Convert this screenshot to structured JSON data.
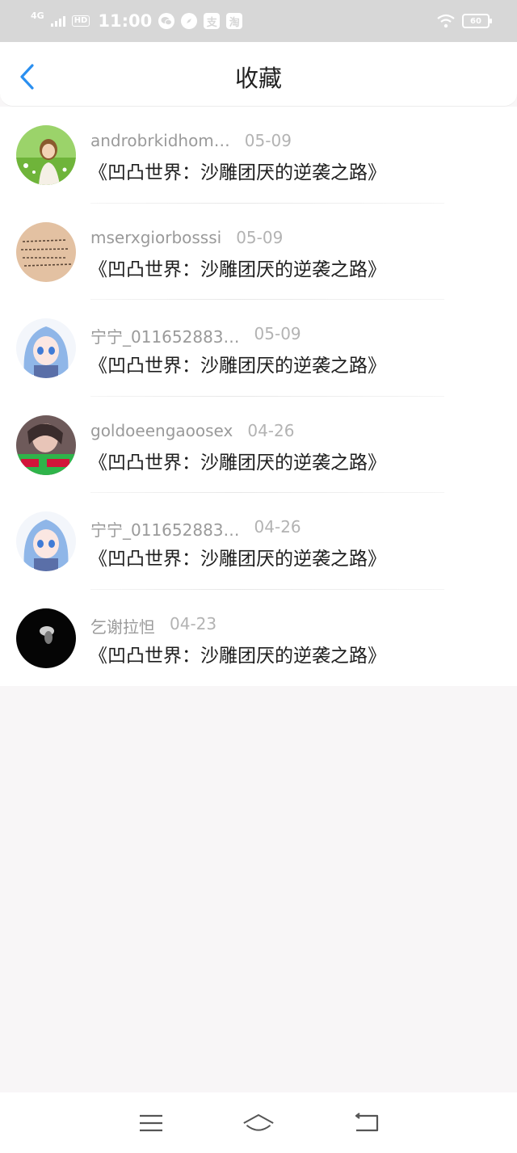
{
  "status_bar": {
    "network": "4G",
    "hd": "HD",
    "time": "11:00",
    "icons": [
      "wechat-icon",
      "compass-icon",
      "alipay-icon",
      "taobao-icon"
    ],
    "icon_glyphs": [
      "",
      "",
      "支",
      "淘"
    ],
    "battery": "60"
  },
  "header": {
    "title": "收藏",
    "back_icon": "chevron-left-icon",
    "accent": "#2a8ff0"
  },
  "items": [
    {
      "name": "androbrkidhom…",
      "date": "05-09",
      "book": "《凹凸世界：沙雕团厌的逆袭之路》",
      "avatar": "girl-field-photo"
    },
    {
      "name": "mserxgiorbosssi",
      "date": "05-09",
      "book": "《凹凸世界：沙雕团厌的逆袭之路》",
      "avatar": "handwriting-photo"
    },
    {
      "name": "宁宁_011652883…",
      "date": "05-09",
      "book": "《凹凸世界：沙雕团厌的逆袭之路》",
      "avatar": "anime-girl-blue"
    },
    {
      "name": "goldoeengaoosex",
      "date": "04-26",
      "book": "《凹凸世界：沙雕团厌的逆袭之路》",
      "avatar": "girl-green-banner"
    },
    {
      "name": "宁宁_011652883…",
      "date": "04-26",
      "book": "《凹凸世界：沙雕团厌的逆袭之路》",
      "avatar": "anime-girl-blue"
    },
    {
      "name": "乞谢拉怛",
      "date": "04-23",
      "book": "《凹凸世界：沙雕团厌的逆袭之路》",
      "avatar": "dark-silhouette"
    }
  ],
  "nav": {
    "icons": [
      "menu-icon",
      "home-icon",
      "back-icon"
    ]
  }
}
